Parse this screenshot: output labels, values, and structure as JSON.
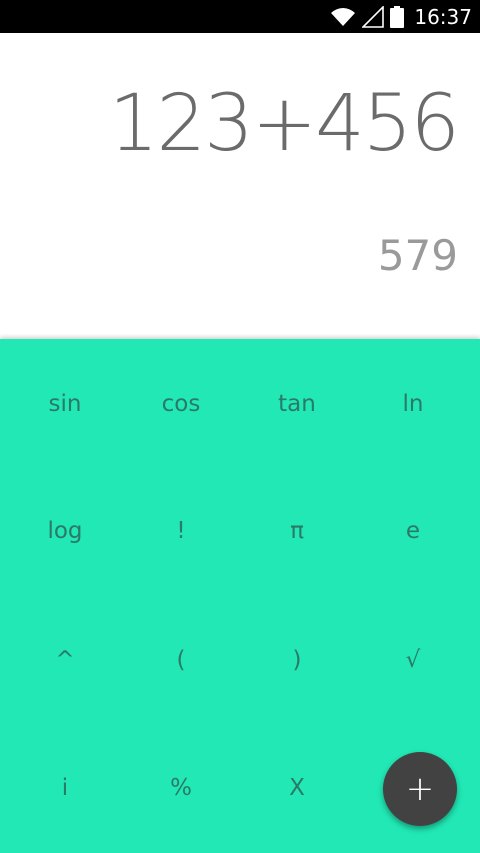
{
  "status_bar": {
    "time": "16:37",
    "icons": [
      "wifi-icon",
      "signal-icon",
      "battery-icon"
    ]
  },
  "display": {
    "expression": "123+456",
    "result": "579"
  },
  "pad": {
    "background_color": "#21e8b5",
    "text_color": "#2b7a68",
    "rows": [
      [
        {
          "name": "sin",
          "label": "sin"
        },
        {
          "name": "cos",
          "label": "cos"
        },
        {
          "name": "tan",
          "label": "tan"
        },
        {
          "name": "ln",
          "label": "ln"
        }
      ],
      [
        {
          "name": "log",
          "label": "log"
        },
        {
          "name": "factorial",
          "label": "!"
        },
        {
          "name": "pi",
          "label": "π"
        },
        {
          "name": "e",
          "label": "e"
        }
      ],
      [
        {
          "name": "power",
          "label": "^"
        },
        {
          "name": "left-paren",
          "label": "("
        },
        {
          "name": "right-paren",
          "label": ")"
        },
        {
          "name": "sqrt",
          "label": "√"
        }
      ],
      [
        {
          "name": "imaginary",
          "label": "i"
        },
        {
          "name": "percent",
          "label": "%"
        },
        {
          "name": "x",
          "label": "X"
        }
      ]
    ]
  },
  "fab": {
    "label": "+",
    "icon": "plus-icon",
    "color": "#424242"
  }
}
